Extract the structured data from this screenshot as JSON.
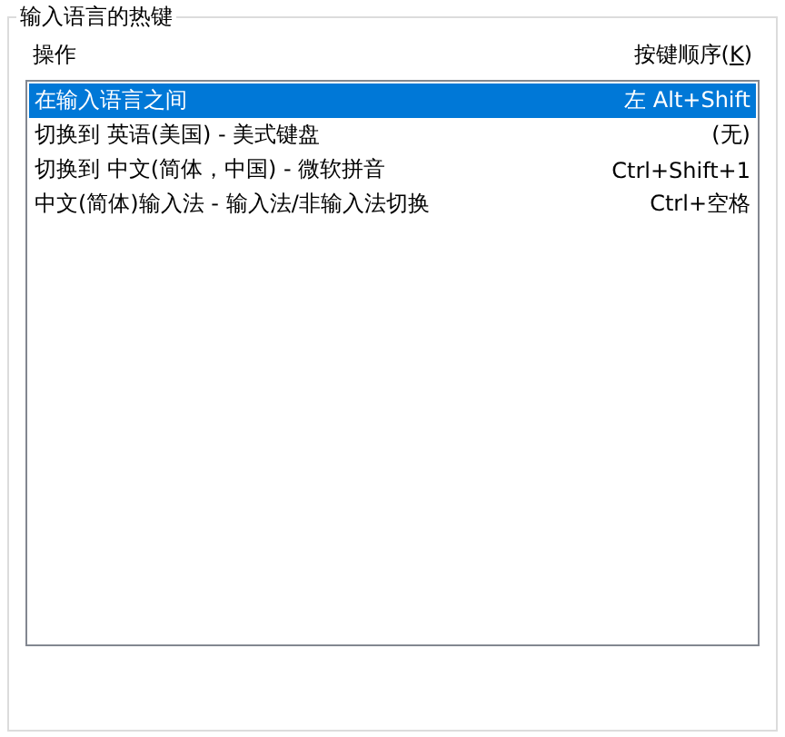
{
  "group": {
    "title": "输入语言的热键"
  },
  "columns": [
    {
      "label": "操作"
    },
    {
      "label": "按键顺序(K)",
      "access_key_underlined": true
    }
  ],
  "rows": [
    {
      "action": "在输入语言之间",
      "keys": "左 Alt+Shift",
      "selected": true
    },
    {
      "action": "切换到 英语(美国) - 美式键盘",
      "keys": "(无)",
      "selected": false
    },
    {
      "action": "切换到 中文(简体，中国) - 微软拼音",
      "keys": "Ctrl+Shift+1",
      "selected": false
    },
    {
      "action": "中文(简体)输入法 - 输入法/非输入法切换",
      "keys": "Ctrl+空格",
      "selected": false
    }
  ]
}
